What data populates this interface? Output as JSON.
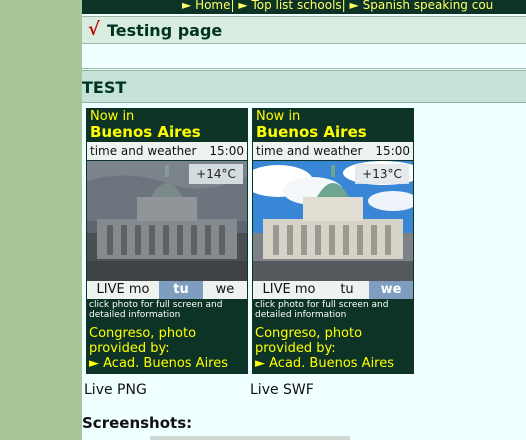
{
  "nav": {
    "items": [
      "Home",
      "Top list schools",
      "Spanish speaking cou"
    ],
    "arrow": "►",
    "separator": "|"
  },
  "page": {
    "title": "Testing page",
    "check_mark": "√",
    "section_title": "TEST",
    "screenshots_label": "Screenshots:"
  },
  "widgets": [
    {
      "now_in": "Now in",
      "city": "Buenos Aires",
      "bar_left": "time and weather",
      "time": "15:00",
      "temp": "+14°C",
      "days": [
        "LIVE mo",
        "tu",
        "we"
      ],
      "active_day": 1,
      "click_text": "click photo for full screen and detailed information",
      "credit_1": "Congreso, photo",
      "credit_2": "provided by:",
      "credit_3": "► Acad. Buenos Aires",
      "caption": "Live PNG",
      "sky": "overcast"
    },
    {
      "now_in": "Now in",
      "city": "Buenos Aires",
      "bar_left": "time and weather",
      "time": "15:00",
      "temp": "+13°C",
      "days": [
        "LIVE mo",
        "tu",
        "we"
      ],
      "active_day": 2,
      "click_text": "click photo for full screen and detailed information",
      "credit_1": "Congreso, photo",
      "credit_2": "provided by:",
      "credit_3": "► Acad. Buenos Aires",
      "caption": "Live SWF",
      "sky": "sunny"
    }
  ],
  "colors": {
    "page_bg": "#f0ffff",
    "outer_bg": "#a7c79a",
    "widget_bg": "#0d3327",
    "accent_yellow": "#ffff00",
    "day_active": "#7f9ebf"
  }
}
